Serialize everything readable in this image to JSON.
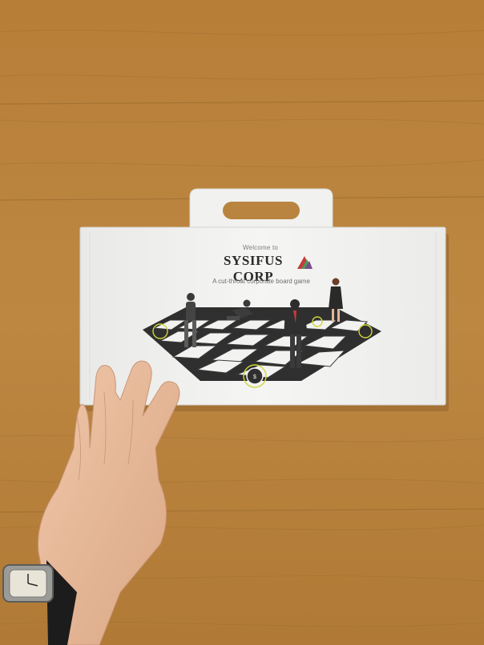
{
  "box": {
    "welcome": "Welcome to",
    "brand": "SYSIFUS CORP",
    "tagline": "A cut-throat corporate board game"
  },
  "colors": {
    "wood": "#b6813d",
    "box_white": "#f3f3f1",
    "tile_dark": "#3a3a3a",
    "tile_accent": "#cfd63a",
    "logo_red": "#c8393d",
    "logo_green": "#4c9b4f",
    "logo_purple": "#7c4b8f"
  }
}
